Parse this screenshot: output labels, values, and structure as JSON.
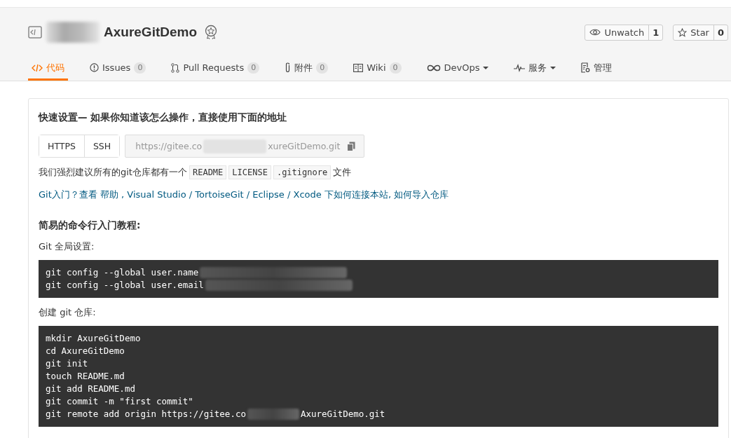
{
  "repo": {
    "name": "AxureGitDemo"
  },
  "actions": [
    {
      "label": "Unwatch",
      "count": "1"
    },
    {
      "label": "Star",
      "count": "0"
    }
  ],
  "tabs": [
    {
      "label": "代码",
      "selected": true,
      "dropdown": false
    },
    {
      "label": "Issues",
      "count": "0",
      "selected": false,
      "dropdown": false
    },
    {
      "label": "Pull Requests",
      "count": "0",
      "selected": false,
      "dropdown": false
    },
    {
      "label": "附件",
      "count": "0",
      "selected": false,
      "dropdown": false
    },
    {
      "label": "Wiki",
      "count": "0",
      "selected": false,
      "dropdown": false
    },
    {
      "label": "DevOps",
      "selected": false,
      "dropdown": true
    },
    {
      "label": "服务",
      "selected": false,
      "dropdown": true
    },
    {
      "label": "管理",
      "selected": false,
      "dropdown": false
    }
  ],
  "quick_setup": {
    "title": "快速设置— 如果你知道该怎么操作，直接使用下面的地址",
    "protocols": [
      {
        "label": "HTTPS",
        "selected": false
      },
      {
        "label": "SSH",
        "selected": false
      }
    ],
    "url_start": "https://gitee.co",
    "url_end": "xureGitDemo.git",
    "recommend": {
      "text": "我们强烈建议所有的git仓库都有一个",
      "files": [
        "README",
        "LICENSE",
        ".gitignore"
      ],
      "suffix": "文件"
    },
    "intro": {
      "lead": "Git入门？查看",
      "links": [
        {
          "text": "帮助",
          "sep": " , "
        },
        {
          "text": "Visual Studio",
          "sep": " / "
        },
        {
          "text": "TortoiseGit",
          "sep": " / "
        },
        {
          "text": "Eclipse",
          "sep": " / "
        },
        {
          "text": "Xcode"
        }
      ],
      "middle": " 下如何连接本站, ",
      "last_link": "如何导入仓库"
    }
  },
  "tutorial": {
    "title": "简易的命令行入门教程:",
    "sections": [
      {
        "label": "Git 全局设置:",
        "lines": [
          {
            "text": "git config --global user.name",
            "blurred": true
          },
          {
            "text": "git config --global user.email",
            "blurred": true
          }
        ]
      },
      {
        "label": "创建 git 仓库:",
        "lines": [
          {
            "text": "mkdir AxureGitDemo"
          },
          {
            "text": "cd AxureGitDemo"
          },
          {
            "text": "git init"
          },
          {
            "text": "touch README.md"
          },
          {
            "text": "git add README.md"
          },
          {
            "text": "git commit -m \"first commit\""
          },
          {
            "text": "git remote add origin https://gitee.co",
            "blurred": true,
            "after": "AxureGitDemo.git"
          }
        ]
      }
    ]
  }
}
